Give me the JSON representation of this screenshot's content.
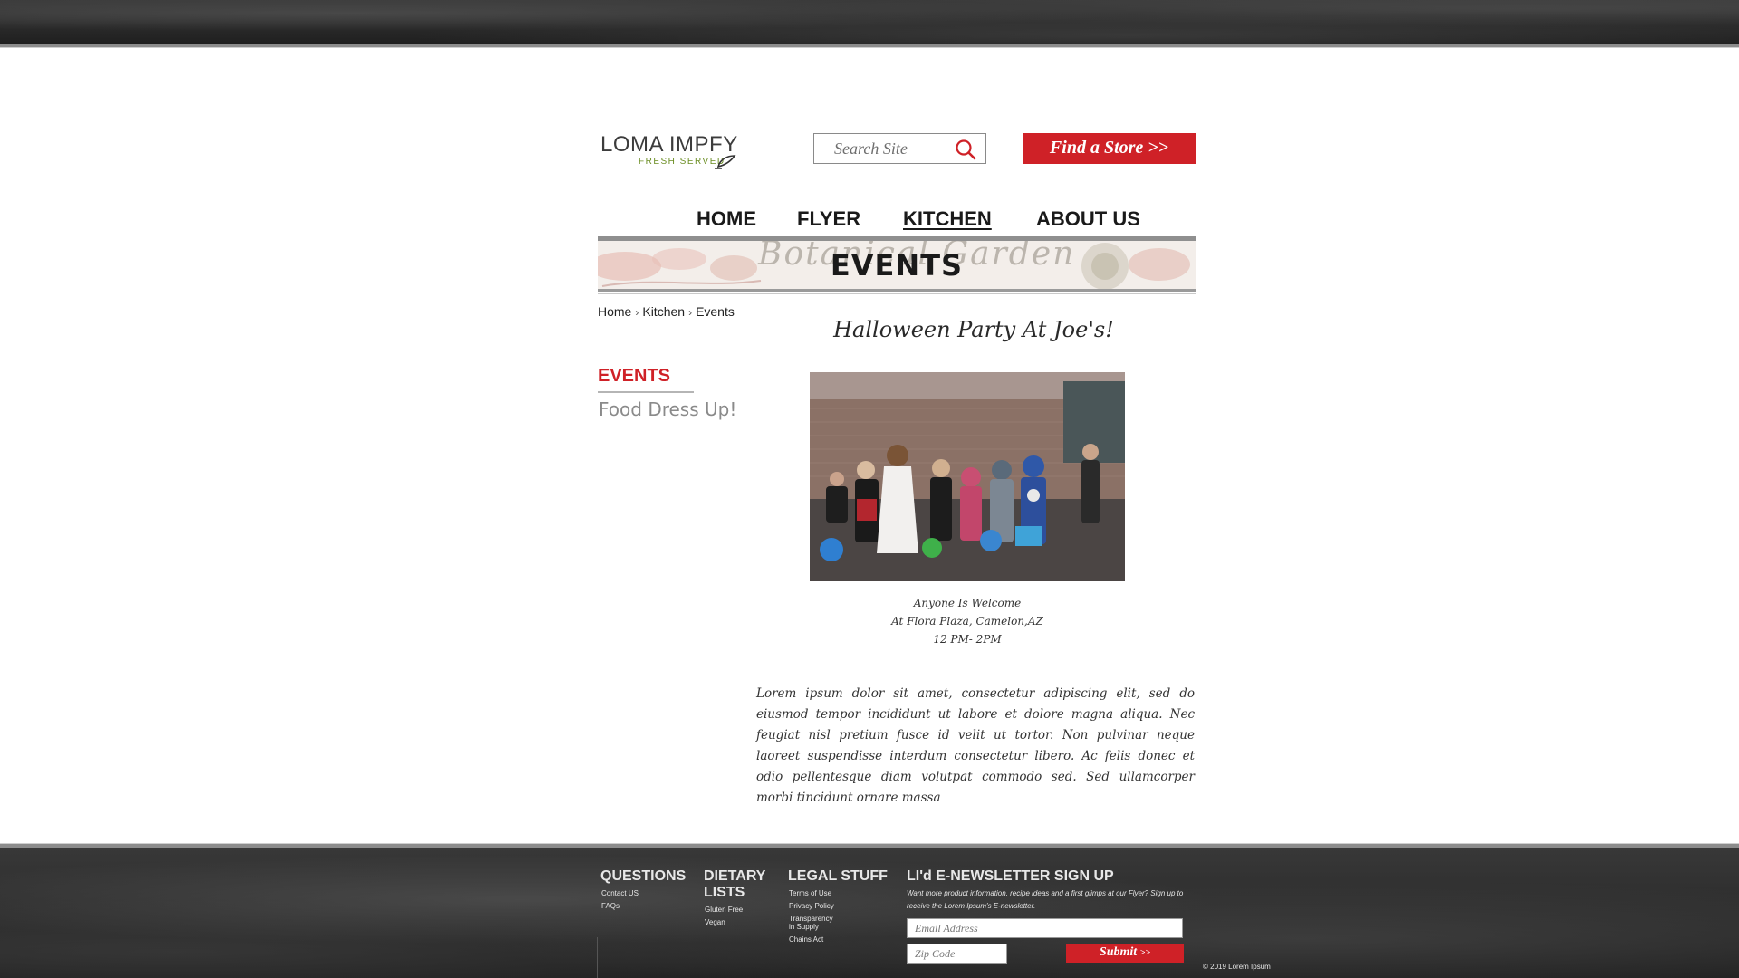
{
  "header": {
    "logo_title": "LOMA IMPFY",
    "logo_sub": "FRESH  SERVED",
    "search_placeholder": "Search Site",
    "store_button": "Find a Store >>"
  },
  "nav": {
    "items": [
      {
        "label": "HOME"
      },
      {
        "label": "FLYER"
      },
      {
        "label": "KITCHEN",
        "active": true
      },
      {
        "label": "ABOUT US"
      }
    ]
  },
  "banner": {
    "script_text": "Botanical Garden",
    "title": "EVENTS"
  },
  "breadcrumb": {
    "items": [
      "Home",
      "Kitchen",
      "Events"
    ],
    "separator": "›"
  },
  "sidebar": {
    "title": "EVENTS",
    "items": [
      "Food Dress Up!"
    ]
  },
  "event": {
    "title": "Halloween Party At Joe's!",
    "caption": [
      "Anyone Is Welcome",
      "At Flora Plaza, Camelon,AZ",
      "12 PM- 2PM"
    ],
    "body": "Lorem ipsum dolor sit amet, consectetur adipiscing elit, sed do eiusmod tempor incididunt ut labore et dolore magna aliqua. Nec feugiat nisl pretium fusce id velit ut tortor. Non pulvinar neque laoreet suspendisse interdum consectetur libero. Ac felis donec et odio pellentesque diam volutpat commodo sed. Sed ullamcorper morbi tincidunt ornare massa"
  },
  "footer": {
    "questions": {
      "title": "QUESTIONS",
      "links": [
        "Contact US",
        "FAQs"
      ]
    },
    "dietary": {
      "title_line1": "DIETARY",
      "title_line2": "LISTS",
      "links": [
        "Gluten Free",
        "Vegan"
      ]
    },
    "legal": {
      "title": "LEGAL STUFF",
      "links": [
        "Terms of Use",
        "Privacy Policy",
        "Transparency",
        "in Supply",
        "Chains Act"
      ]
    },
    "newsletter": {
      "title": "LI'd E-NEWSLETTER SIGN UP",
      "blurb": "Want more product information, recipe ideas and a first glimps at our Flyer? Sign up to receive the Lorem Ipsum's E-newsletter.",
      "email_placeholder": "Email Address",
      "zip_placeholder": "Zip Code",
      "submit_label": "Submit",
      "submit_suffix": ">>"
    },
    "copyright": "© 2019 Lorem Ipsum"
  },
  "colors": {
    "accent_red": "#cf2127",
    "logo_green": "#6b8e23",
    "dark_band": "#2a2a2a"
  }
}
